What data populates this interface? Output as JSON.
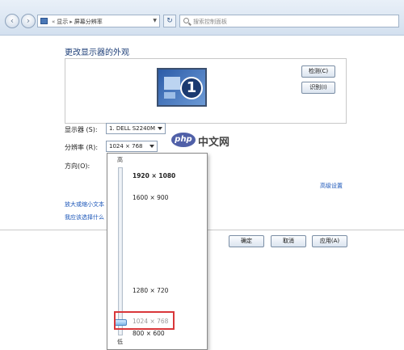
{
  "navigation": {
    "breadcrumbs": [
      "显示",
      "屏幕分辨率"
    ],
    "search_placeholder": "搜索控制面板"
  },
  "page": {
    "title": "更改显示器的外观",
    "monitor_number": "1",
    "detect_label": "检测(C)",
    "identify_label": "识别(I)"
  },
  "settings": {
    "display_label": "显示器 (S):",
    "display_value": "1. DELL S2240M",
    "resolution_label": "分辨率 (R):",
    "resolution_value": "1024 × 768",
    "orientation_label": "方向(O):",
    "advanced_link": "高级设置",
    "link_text_size": "放大或缩小文本",
    "link_choose": "我应该选择什么"
  },
  "resolution_popup": {
    "high_label": "高",
    "low_label": "低",
    "options": [
      {
        "label": "1920 × 1080",
        "style": "bold"
      },
      {
        "label": "1600 × 900",
        "style": "normal"
      },
      {
        "label": "1280 × 720",
        "style": "normal"
      },
      {
        "label": "1024 × 768",
        "style": "muted"
      },
      {
        "label": "800 × 600",
        "style": "normal"
      }
    ],
    "selected": "1024 × 768"
  },
  "footer": {
    "ok_label": "确定",
    "cancel_label": "取消",
    "apply_label": "应用(A)"
  },
  "watermark": {
    "logo": "php",
    "text": "中文网"
  },
  "colors": {
    "link": "#1a55b8",
    "title": "#1e3f78",
    "highlight": "#d9373a"
  }
}
